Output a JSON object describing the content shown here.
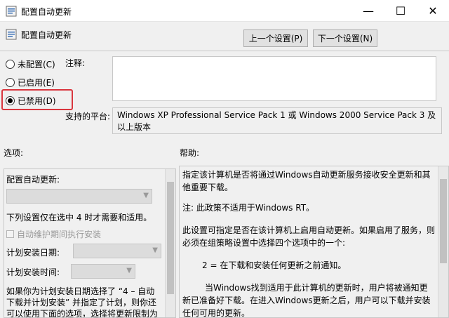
{
  "window": {
    "title": "配置自动更新",
    "min": "—",
    "max": "☐",
    "close": "✕"
  },
  "header": {
    "title": "配置自动更新"
  },
  "nav": {
    "prev": "上一个设置(P)",
    "next": "下一个设置(N)"
  },
  "state": {
    "options": [
      {
        "label": "未配置(C)",
        "checked": false
      },
      {
        "label": "已启用(E)",
        "checked": false
      },
      {
        "label": "已禁用(D)",
        "checked": true
      }
    ]
  },
  "comment": {
    "label": "注释:"
  },
  "platform": {
    "label": "支持的平台:",
    "value": "Windows XP Professional Service Pack 1 或 Windows 2000 Service Pack 3 及以上版本"
  },
  "sections": {
    "options": "选项:",
    "help": "帮助:"
  },
  "options_panel": {
    "title": "配置自动更新:",
    "note": "下列设置仅在选中 4 时才需要和适用。",
    "maint_checkbox": "自动维护期间执行安装",
    "schedule_day": "计划安装日期:",
    "schedule_time": "计划安装时间:",
    "paragraph": "如果你为计划安装日期选择了 “4 – 自动下载并计划安装” 并指定了计划，则你还可以使用下面的选项，选择将更新限制为每周、每两周或每月"
  },
  "help_panel": {
    "p1": "指定该计算机是否将通过Windows自动更新服务接收安全更新和其他重要下载。",
    "p2": "注: 此政策不适用于Windows RT。",
    "p3": "此设置可指定是否在该计算机上启用自动更新。如果启用了服务，则必须在组策略设置中选择四个选项中的一个:",
    "p4": "2 = 在下载和安装任何更新之前通知。",
    "p5": "当Windows找到适用于此计算机的更新时，用户将被通知更新已准备好下载。在进入Windows更新之后，用户可以下载并安装任何可用的更新。"
  }
}
